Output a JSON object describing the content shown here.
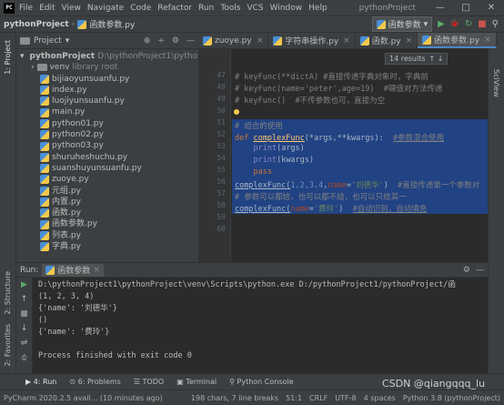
{
  "title_bar": {
    "logo": "PC",
    "menu": [
      "File",
      "Edit",
      "View",
      "Navigate",
      "Code",
      "Refactor",
      "Run",
      "Tools",
      "VCS",
      "Window",
      "Help"
    ],
    "window_title": "pythonProject",
    "controls": [
      "—",
      "□",
      "✕"
    ]
  },
  "nav_bar": {
    "project": "pythonProject",
    "file": "函数参数.py",
    "run_config": "函数参数",
    "buttons": [
      "▶",
      "🐞",
      "↻",
      "■",
      "⚲"
    ]
  },
  "side_tabs": {
    "left_top": "1: Project",
    "left_mid": "2: Structure",
    "left_bottom": "2: Favorites",
    "right": "SciView"
  },
  "project_panel": {
    "title": "Project",
    "tools": [
      "⊕",
      "÷",
      "⚙",
      "—"
    ],
    "root": {
      "name": "pythonProject",
      "path": "D:\\pythonProject1\\pythonProject"
    },
    "venv": {
      "name": "venv",
      "note": "library root"
    },
    "files": [
      "bijiaoyunsuanfu.py",
      "index.py",
      "luojiyunsuanfu.py",
      "main.py",
      "python01.py",
      "python02.py",
      "python03.py",
      "shuruheshuchu.py",
      "suanshuyunsuanfu.py",
      "zuoye.py",
      "元组.py",
      "内置.py",
      "函数.py",
      "函数参数.py",
      "列表.py",
      "字典.py"
    ]
  },
  "editor_tabs": [
    {
      "label": "zuoye.py",
      "active": false
    },
    {
      "label": "字符串操作.py",
      "active": false
    },
    {
      "label": "函数.py",
      "active": false
    },
    {
      "label": "函数参数.py",
      "active": true
    }
  ],
  "occurrences": {
    "count": "14 results",
    "arrows": "↑ ↓"
  },
  "line_numbers": [
    "47",
    "48",
    "49",
    "50",
    "51",
    "52",
    "53",
    "54",
    "55",
    "56",
    "57",
    "58",
    "59",
    "60"
  ],
  "code": {
    "l47_a": "# keyFunc(**dictA) ",
    "l47_b": "#直接传递字典对象时，字典前",
    "l48": "# keyFunc(name='peter',age=19)  #键值对方法传递",
    "l49": "# keyFunc()  #不传参数也可，直接为空",
    "l51": "# 组合的使用",
    "l52_def": "def",
    "l52_name": "complexFunc",
    "l52_args": "(*args,**kwargs):",
    "l52_cm": "#参数混合使用",
    "l53_print": "print",
    "l53_arg": "(args)",
    "l54_print": "print",
    "l54_arg": "(kwargs)",
    "l55": "pass",
    "l56_call": "complexFunc(",
    "l56_nums": "1,2,3,4",
    "l56_comma": ",",
    "l56_kw": "name",
    "l56_eq": "=",
    "l56_str": "'刘德华'",
    "l56_close": ")",
    "l56_cm": "#直接传递第一个参数对",
    "l57": "# 参数可以都给，也可以都不给，也可以只给其一",
    "l58_call": "complexFunc(",
    "l58_kw": "name",
    "l58_eq": "=",
    "l58_str": "'费玲'",
    "l58_close": ")",
    "l58_cm": "#自动识别，自动填充"
  },
  "run_panel": {
    "label": "Run:",
    "config": "函数参数",
    "tools": [
      "⚙",
      "—"
    ],
    "side_tools": [
      "▶",
      "↑",
      "■",
      "↓",
      "⇌",
      "⎙",
      "📌",
      "🗑"
    ],
    "output": [
      "D:\\pythonProject1\\pythonProject\\venv\\Scripts\\python.exe D:/pythonProject1/pythonProject/函",
      "(1, 2, 3, 4)",
      "{'name': '刘德华'}",
      "()",
      "{'name': '费玲'}",
      "",
      "Process finished with exit code 0"
    ]
  },
  "bottom_tabs": [
    "▶ 4: Run",
    "⊙ 6: Problems",
    "☰ TODO",
    "▣ Terminal",
    "⚲ Python Console"
  ],
  "status_bar": {
    "left": "PyCharm 2020.2.5 avail... (10 minutes ago)",
    "items": [
      "198 chars, 7 line breaks",
      "51:1",
      "CRLF",
      "UTF-8",
      "4 spaces",
      "Python 3.8 (pythonProject)"
    ]
  },
  "watermark": "CSDN @qiangqqq_lu"
}
